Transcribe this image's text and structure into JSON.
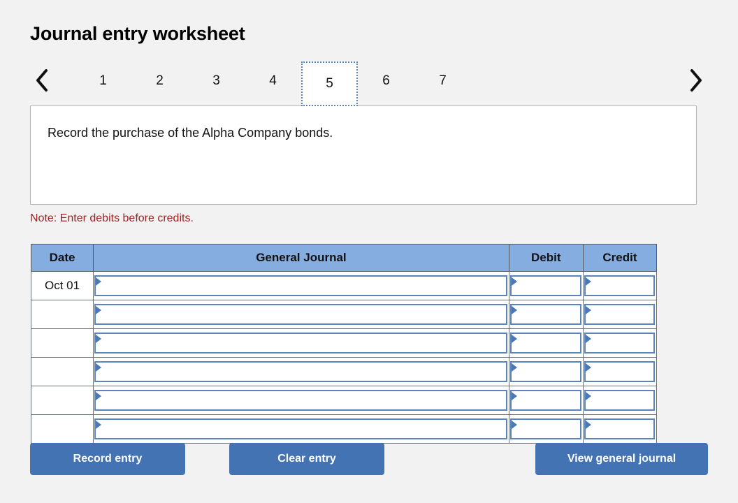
{
  "page": {
    "title": "Journal entry worksheet",
    "background_color": "#f2f2f2"
  },
  "navigation": {
    "prev_icon": "chevron-left-icon",
    "next_icon": "chevron-right-icon",
    "active_tab": "5",
    "tabs": [
      {
        "label": "1"
      },
      {
        "label": "2"
      },
      {
        "label": "3"
      },
      {
        "label": "4"
      },
      {
        "label": "5"
      },
      {
        "label": "6"
      },
      {
        "label": "7"
      }
    ]
  },
  "requirement": {
    "text": "Record the purchase of the Alpha Company bonds."
  },
  "note": {
    "text": "Note: Enter debits before credits."
  },
  "journal": {
    "columns": {
      "date": "Date",
      "general_journal": "General Journal",
      "debit": "Debit",
      "credit": "Credit"
    },
    "rows": [
      {
        "date": "Oct 01",
        "account": "",
        "debit": "",
        "credit": ""
      },
      {
        "date": "",
        "account": "",
        "debit": "",
        "credit": ""
      },
      {
        "date": "",
        "account": "",
        "debit": "",
        "credit": ""
      },
      {
        "date": "",
        "account": "",
        "debit": "",
        "credit": ""
      },
      {
        "date": "",
        "account": "",
        "debit": "",
        "credit": ""
      },
      {
        "date": "",
        "account": "",
        "debit": "",
        "credit": ""
      }
    ]
  },
  "buttons": {
    "record_entry": "Record entry",
    "clear_entry": "Clear entry",
    "view_general_journal": "View general journal"
  },
  "colors": {
    "header_blue": "#85ADE0",
    "button_blue": "#4473B3",
    "field_border_blue": "#5b84bd",
    "note_red": "#9a2222",
    "page_background": "#f2f2f2"
  }
}
